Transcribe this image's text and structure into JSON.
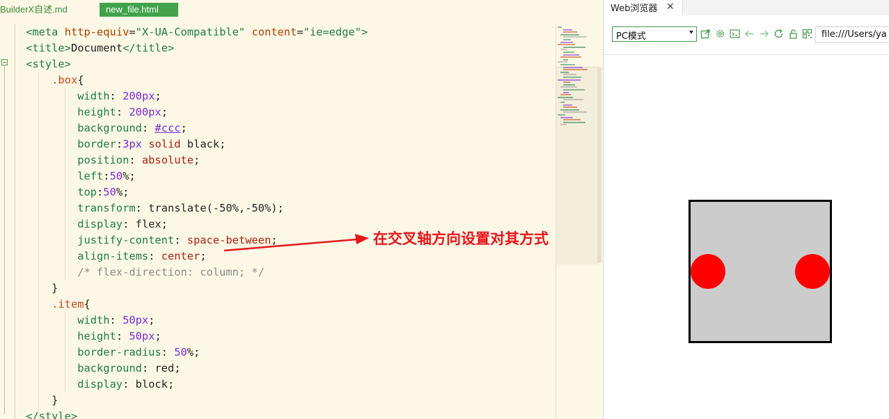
{
  "editor": {
    "tabs": [
      {
        "label": "BuilderX自述.md"
      },
      {
        "label": "new_file.html",
        "active": true
      }
    ],
    "lines": [
      [
        [
          "t-plain",
          "    "
        ],
        [
          "t-tag",
          "<meta "
        ],
        [
          "t-attr",
          "http-equiv"
        ],
        [
          "t-plain",
          "="
        ],
        [
          "t-str",
          "\"X-UA-Compatible\" "
        ],
        [
          "t-attr",
          "content"
        ],
        [
          "t-plain",
          "="
        ],
        [
          "t-str",
          "\"ie=edge\""
        ],
        [
          "t-tag",
          ">"
        ]
      ],
      [
        [
          "t-plain",
          "    "
        ],
        [
          "t-tag",
          "<title>"
        ],
        [
          "t-plain",
          "Document"
        ],
        [
          "t-tag",
          "</title>"
        ]
      ],
      [
        [
          "t-plain",
          "    "
        ],
        [
          "t-tag",
          "<style>"
        ]
      ],
      [
        [
          "t-plain",
          "        "
        ],
        [
          "t-sel",
          ".box"
        ],
        [
          "t-plain",
          "{"
        ]
      ],
      [
        [
          "t-plain",
          "            "
        ],
        [
          "t-prop",
          "width"
        ],
        [
          "t-plain",
          ": "
        ],
        [
          "t-num",
          "200px"
        ],
        [
          "t-plain",
          ";"
        ]
      ],
      [
        [
          "t-plain",
          "            "
        ],
        [
          "t-prop",
          "height"
        ],
        [
          "t-plain",
          ": "
        ],
        [
          "t-num",
          "200px"
        ],
        [
          "t-plain",
          ";"
        ]
      ],
      [
        [
          "t-plain",
          "            "
        ],
        [
          "t-prop",
          "background"
        ],
        [
          "t-plain",
          ": "
        ],
        [
          "t-hex",
          "#ccc"
        ],
        [
          "t-plain",
          ";"
        ]
      ],
      [
        [
          "t-plain",
          "            "
        ],
        [
          "t-prop",
          "border"
        ],
        [
          "t-plain",
          ":"
        ],
        [
          "t-num",
          "3px"
        ],
        [
          "t-plain",
          " "
        ],
        [
          "t-kw",
          "solid"
        ],
        [
          "t-plain",
          " black;"
        ]
      ],
      [
        [
          "t-plain",
          "            "
        ],
        [
          "t-prop",
          "position"
        ],
        [
          "t-plain",
          ": "
        ],
        [
          "t-kw",
          "absolute"
        ],
        [
          "t-plain",
          ";"
        ]
      ],
      [
        [
          "t-plain",
          "            "
        ],
        [
          "t-prop",
          "left"
        ],
        [
          "t-plain",
          ":"
        ],
        [
          "t-num",
          "50"
        ],
        [
          "t-plain",
          "%;"
        ]
      ],
      [
        [
          "t-plain",
          "            "
        ],
        [
          "t-prop",
          "top"
        ],
        [
          "t-plain",
          ":"
        ],
        [
          "t-num",
          "50"
        ],
        [
          "t-plain",
          "%;"
        ]
      ],
      [
        [
          "t-plain",
          "            "
        ],
        [
          "t-prop",
          "transform"
        ],
        [
          "t-plain",
          ": translate(-50%,-50%);"
        ]
      ],
      [
        [
          "t-plain",
          "            "
        ],
        [
          "t-prop",
          "display"
        ],
        [
          "t-plain",
          ": flex;"
        ]
      ],
      [
        [
          "t-plain",
          "            "
        ],
        [
          "t-prop",
          "justify-content"
        ],
        [
          "t-plain",
          ": "
        ],
        [
          "t-kw",
          "space-between"
        ],
        [
          "t-plain",
          ";"
        ]
      ],
      [
        [
          "t-plain",
          "            "
        ],
        [
          "t-prop",
          "align-items"
        ],
        [
          "t-plain",
          ": "
        ],
        [
          "t-kw",
          "center"
        ],
        [
          "t-plain",
          ";"
        ]
      ],
      [
        [
          "t-plain",
          "            "
        ],
        [
          "t-com",
          "/* flex-direction: column; */"
        ]
      ],
      [
        [
          "t-plain",
          "        }"
        ]
      ],
      [
        [
          "t-plain",
          "        "
        ],
        [
          "t-sel",
          ".item"
        ],
        [
          "t-plain",
          "{"
        ]
      ],
      [
        [
          "t-plain",
          "            "
        ],
        [
          "t-prop",
          "width"
        ],
        [
          "t-plain",
          ": "
        ],
        [
          "t-num",
          "50px"
        ],
        [
          "t-plain",
          ";"
        ]
      ],
      [
        [
          "t-plain",
          "            "
        ],
        [
          "t-prop",
          "height"
        ],
        [
          "t-plain",
          ": "
        ],
        [
          "t-num",
          "50px"
        ],
        [
          "t-plain",
          ";"
        ]
      ],
      [
        [
          "t-plain",
          "            "
        ],
        [
          "t-prop",
          "border-radius"
        ],
        [
          "t-plain",
          ": "
        ],
        [
          "t-num",
          "50"
        ],
        [
          "t-plain",
          "%;"
        ]
      ],
      [
        [
          "t-plain",
          "            "
        ],
        [
          "t-prop",
          "background"
        ],
        [
          "t-plain",
          ": red;"
        ]
      ],
      [
        [
          "t-plain",
          "            "
        ],
        [
          "t-prop",
          "display"
        ],
        [
          "t-plain",
          ": block;"
        ]
      ],
      [
        [
          "t-plain",
          "        }"
        ]
      ],
      [
        [
          "t-plain",
          "    "
        ],
        [
          "t-tag",
          "</style>"
        ]
      ]
    ]
  },
  "annotation": {
    "text": "在交叉轴方向设置对其方式",
    "color": "#e8141b"
  },
  "browser": {
    "tab_label": "Web浏览器",
    "tab_close": "✕",
    "mode_select": "PC模式",
    "url": "file:///Users/ya",
    "toolbar_icons": [
      "open-in-window-icon",
      "settings-gear-icon",
      "console-icon",
      "back-arrow-icon",
      "forward-arrow-icon",
      "refresh-icon",
      "lock-icon",
      "qr-code-icon"
    ],
    "demo": {
      "justify_content": "space-between",
      "align_items": "center",
      "item_count": 2,
      "box_color": "#cccccc",
      "item_color": "#ff0000"
    }
  }
}
